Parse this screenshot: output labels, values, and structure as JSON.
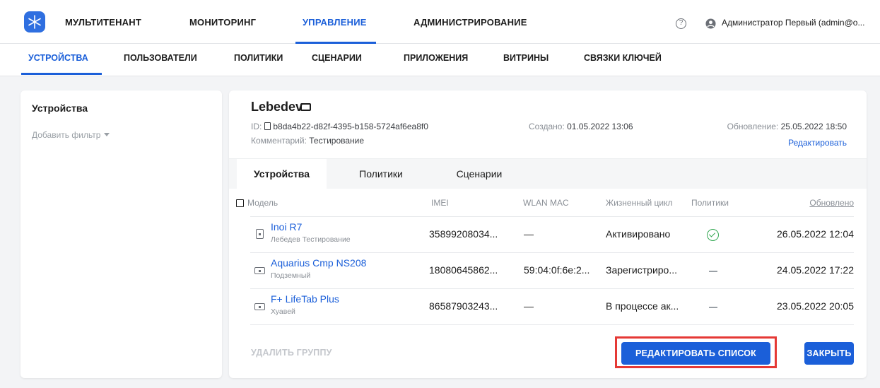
{
  "top_nav": {
    "items": [
      "МУЛЬТИТЕНАНТ",
      "МОНИТОРИНГ",
      "УПРАВЛЕНИЕ",
      "АДМИНИСТРИРОВАНИЕ"
    ],
    "active": "УПРАВЛЕНИЕ",
    "help_icon": "help-circle-icon",
    "user_icon": "account-circle-icon",
    "user_name": "Администратор Первый (admin@o..."
  },
  "sub_nav": {
    "items": [
      "УСТРОЙСТВА",
      "ПОЛЬЗОВАТЕЛИ",
      "ПОЛИТИКИ",
      "СЦЕНАРИИ",
      "ПРИЛОЖЕНИЯ",
      "ВИТРИНЫ",
      "СВЯЗКИ КЛЮЧЕЙ"
    ],
    "active": "УСТРОЙСТВА"
  },
  "sidebar": {
    "title": "Устройства",
    "add_filter": "Добавить фильтр"
  },
  "detail": {
    "name": "Lebedev",
    "id_label": "ID:",
    "id_value": "b8da4b22-d82f-4395-b158-5724af6ea8f0",
    "comment_label": "Комментарий:",
    "comment_value": "Тестирование",
    "created_label": "Создано:",
    "created_value": "01.05.2022 13:06",
    "updated_label": "Обновление:",
    "updated_value": "25.05.2022 18:50",
    "edit_link": "Редактировать"
  },
  "tabs": [
    "Устройства",
    "Политики",
    "Сценарии"
  ],
  "active_tab": "Устройства",
  "table": {
    "columns": [
      "Модель",
      "IMEI",
      "WLAN MAC",
      "Жизненный цикл",
      "Политики",
      "Обновлено"
    ],
    "rows": [
      {
        "model": "Inoi R7",
        "owner": "Лебедев Тестирование",
        "imei": "35899208034...",
        "wlan_mac": "—",
        "lifecycle": "Активировано",
        "policy_status": "ok",
        "updated": "26.05.2022 12:04",
        "device_icon": "smartphone-icon"
      },
      {
        "model": "Aquarius Cmp NS208",
        "owner": "Подземный",
        "imei": "18080645862...",
        "wlan_mac": "59:04:0f:6e:2...",
        "lifecycle": "Зарегистриро...",
        "policy_status": "none",
        "updated": "24.05.2022 17:22",
        "device_icon": "tablet-icon"
      },
      {
        "model": "F+ LifeTab Plus",
        "owner": "Хуавей",
        "imei": "86587903243...",
        "wlan_mac": "—",
        "lifecycle": "В процессе ак...",
        "policy_status": "none",
        "updated": "23.05.2022 20:05",
        "device_icon": "tablet-icon"
      }
    ]
  },
  "actions": {
    "delete_group": "УДАЛИТЬ ГРУППУ",
    "edit_list": "РЕДАКТИРОВАТЬ СПИСОК",
    "close": "ЗАКРЫТЬ"
  },
  "colors": {
    "accent": "#1b5fd9",
    "highlight": "#e53935",
    "ok": "#34a853"
  }
}
